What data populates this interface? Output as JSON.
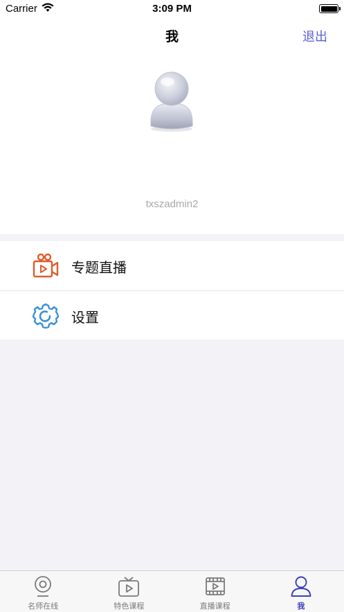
{
  "status_bar": {
    "carrier": "Carrier",
    "time": "3:09 PM"
  },
  "nav": {
    "title": "我",
    "logout_label": "退出"
  },
  "profile": {
    "username": "txszadmin2"
  },
  "menu": {
    "items": [
      {
        "label": "专题直播",
        "icon": "video-camera-icon"
      },
      {
        "label": "设置",
        "icon": "gear-icon"
      }
    ]
  },
  "tab_bar": {
    "items": [
      {
        "label": "名师在线",
        "icon": "webcam-icon"
      },
      {
        "label": "特色课程",
        "icon": "tv-play-icon"
      },
      {
        "label": "直播课程",
        "icon": "film-play-icon"
      },
      {
        "label": "我",
        "icon": "person-icon"
      }
    ],
    "active_index": 3
  },
  "colors": {
    "accent": "#5a5fd6",
    "tab_active": "#3a3fb8",
    "live_icon": "#e05a2b",
    "settings_icon": "#3b8fd9"
  }
}
